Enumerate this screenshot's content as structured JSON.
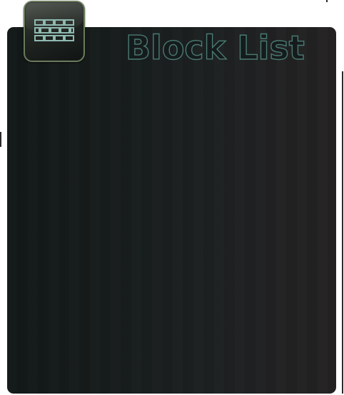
{
  "header": {
    "title": "Block List",
    "icon": "brick-wall-icon"
  },
  "colors": {
    "panel_left": "#121817",
    "panel_right": "#242223",
    "title_fill": "#151b1b",
    "title_outline": "#4a7a72",
    "icon_border": "#6a7a5c",
    "icon_glyph": "#8fb9b0"
  }
}
